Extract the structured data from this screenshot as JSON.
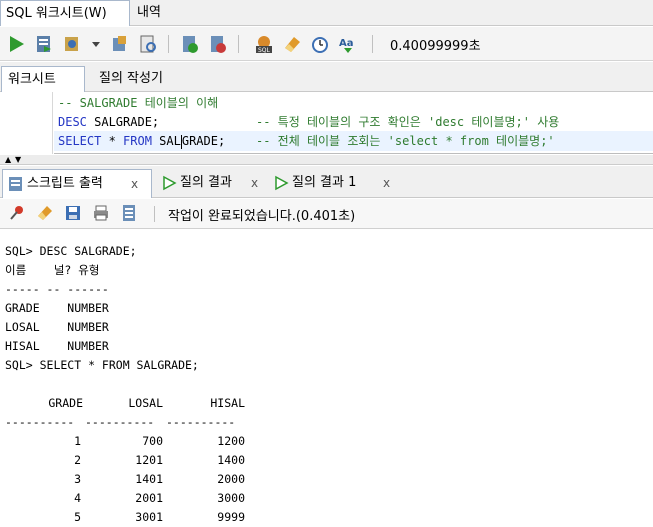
{
  "top_tabs": {
    "worksheet_label": "SQL 워크시트(W)",
    "history_label": "내역"
  },
  "toolbar": {
    "timer": "0.40099999초",
    "icons": [
      "run-statement-icon",
      "run-script-icon",
      "commit-icon",
      "dropdown-icon",
      "rollback-icon",
      "explain-icon",
      "autotrace-icon",
      "sql-tuning-icon",
      "format-icon",
      "clear-icon",
      "history-icon",
      "case-icon"
    ]
  },
  "sub_tabs": {
    "worksheet": "워크시트",
    "query_builder": "질의 작성기"
  },
  "editor": {
    "line1_comment": "-- SALGRADE 테이블의 이해",
    "line2_kw": "DESC",
    "line2_rest": " SALGRADE;",
    "line2_comment": "-- 특정 테이블의 구조 확인은 'desc 테이블명;' 사용",
    "line3_kw1": "SELECT",
    "line3_star": " * ",
    "line3_kw2": "FROM",
    "line3_table_a": " SAL",
    "line3_table_b": "GRADE;",
    "line3_comment": "-- 전체 테이블 조회는 'select * from 테이블명;'"
  },
  "output_tabs": {
    "script_output": "스크립트 출력",
    "query_result": "질의 결과",
    "query_result_1": "질의 결과 1",
    "close": "x"
  },
  "output_toolbar": {
    "status": "작업이 완료되었습니다.(0.401초)"
  },
  "output": {
    "line_desc": "SQL> DESC SALGRADE;",
    "desc_header": "이름    널? 유형",
    "desc_dash": "----- -- ------",
    "desc_rows": [
      "GRADE    NUMBER",
      "LOSAL    NUMBER",
      "HISAL    NUMBER"
    ],
    "line_select": "SQL> SELECT * FROM SALGRADE;",
    "columns": [
      "GRADE",
      "LOSAL",
      "HISAL"
    ],
    "dashes": [
      "----------",
      "----------",
      "----------"
    ],
    "rows": [
      [
        "1",
        "700",
        "1200"
      ],
      [
        "2",
        "1201",
        "1400"
      ],
      [
        "3",
        "1401",
        "2000"
      ],
      [
        "4",
        "2001",
        "3000"
      ],
      [
        "5",
        "3001",
        "9999"
      ]
    ]
  }
}
